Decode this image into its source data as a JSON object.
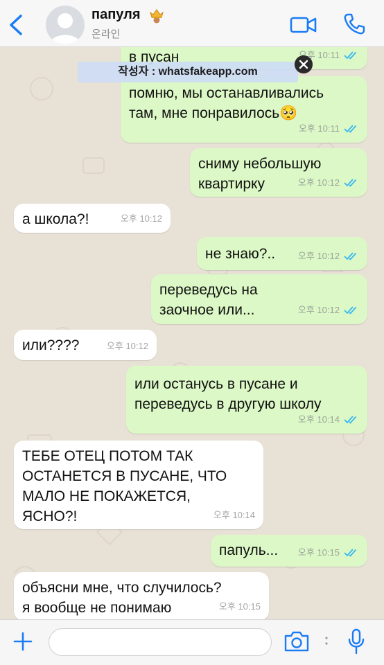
{
  "header": {
    "contact_name": "папуля",
    "status": "온라인",
    "accent": "#1a7cf5"
  },
  "watermark": {
    "text": "작성자 : whatsfakeapp.com"
  },
  "messages": [
    {
      "dir": "out",
      "text": "в пусан",
      "time": "오후 10:11",
      "read": true
    },
    {
      "dir": "out",
      "text": "помню, мы останавливались\nтам, мне понравилось🥺",
      "time": "오후 10:11",
      "read": true
    },
    {
      "dir": "out",
      "text": "сниму небольшую\nквартирку",
      "time": "오후 10:12",
      "read": true
    },
    {
      "dir": "in",
      "text": "а школа?!",
      "time": "오후 10:12"
    },
    {
      "dir": "out",
      "text": "не знаю?..",
      "time": "오후 10:12",
      "read": true
    },
    {
      "dir": "out",
      "text": "переведусь на\nзаочное или...",
      "time": "오후 10:12",
      "read": true
    },
    {
      "dir": "in",
      "text": "или????",
      "time": "오후 10:12"
    },
    {
      "dir": "out",
      "text": "или останусь в пусане и\nпереведусь в другую школу",
      "time": "오후 10:14",
      "read": true
    },
    {
      "dir": "in",
      "text": " ТЕБЕ ОТЕЦ ПОТОМ ТАК\nОСТАНЕТСЯ В ПУСАНЕ, ЧТО\nМАЛО НЕ ПОКАЖЕТСЯ,\nЯСНО?!",
      "time": "오후 10:14"
    },
    {
      "dir": "out",
      "text": "папуль...",
      "time": "오후 10:15",
      "read": true
    },
    {
      "dir": "in",
      "text": "объясни мне, что случилось?\nя вообще не понимаю",
      "time": "오후 10:15"
    }
  ],
  "colors": {
    "outgoing_bubble": "#dcf8c6",
    "incoming_bubble": "#ffffff",
    "read_ticks": "#34b7f1",
    "chat_background": "#e8e1d6"
  },
  "icons": [
    "back-chevron-icon",
    "crown-emoji-icon",
    "video-call-icon",
    "phone-icon",
    "plus-icon",
    "camera-icon",
    "microphone-icon"
  ]
}
